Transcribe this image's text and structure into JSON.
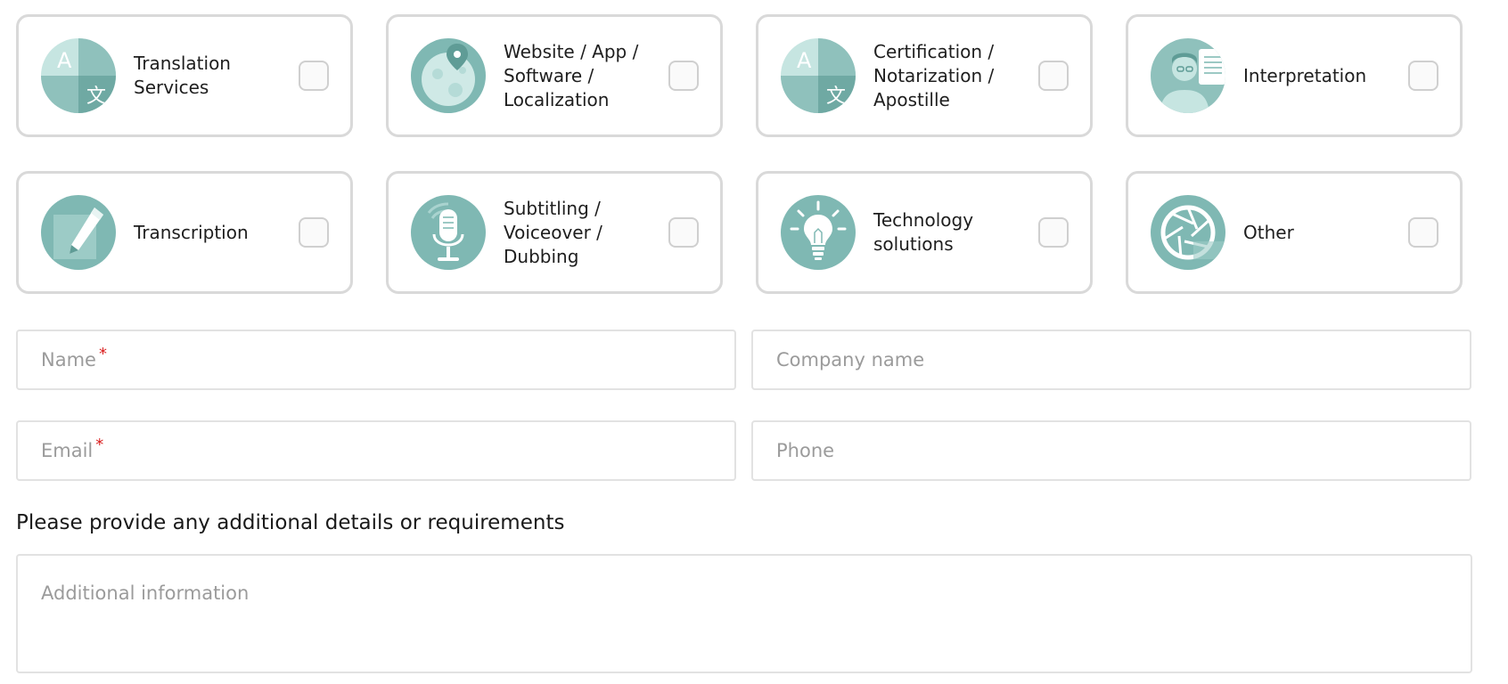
{
  "services": [
    {
      "label": "Translation\nServices",
      "icon": "translation-icon"
    },
    {
      "label": "Website / App /\nSoftware /\nLocalization",
      "icon": "globe-pin-icon"
    },
    {
      "label": "Certification /\nNotarization /\nApostille",
      "icon": "certification-icon"
    },
    {
      "label": "Interpretation",
      "icon": "interpreter-icon"
    },
    {
      "label": "Transcription",
      "icon": "pen-icon"
    },
    {
      "label": "Subtitling /\nVoiceover /\nDubbing",
      "icon": "microphone-icon"
    },
    {
      "label": "Technology\nsolutions",
      "icon": "lightbulb-icon"
    },
    {
      "label": "Other",
      "icon": "aperture-icon"
    }
  ],
  "form": {
    "name_placeholder": "Name",
    "company_placeholder": "Company name",
    "email_placeholder": "Email",
    "phone_placeholder": "Phone",
    "required_mark": "*",
    "details_label": "Please provide any additional details or requirements",
    "additional_placeholder": "Additional information"
  },
  "colors": {
    "icon_teal": "#7fb8b3",
    "icon_light": "#c9e6e3",
    "card_border": "#d9d9d9",
    "required": "#d91e1e"
  }
}
